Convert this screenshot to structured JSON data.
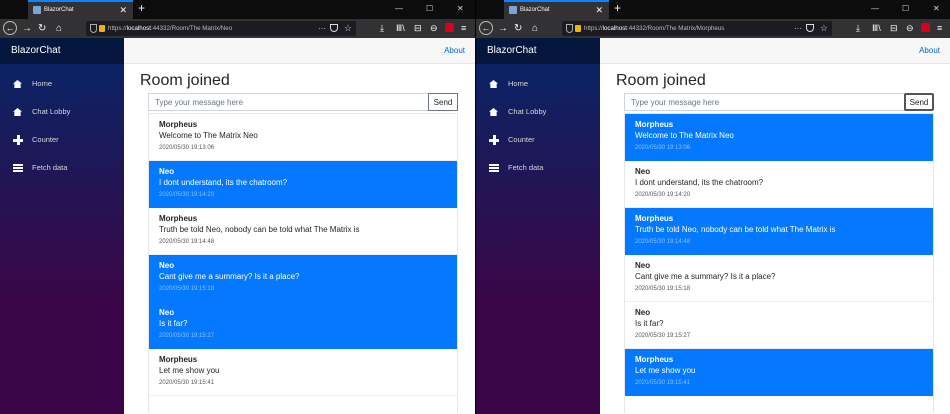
{
  "browser": {
    "tab_title": "BlazorChat",
    "tab_close": "✕",
    "new_tab": "+",
    "window_controls": [
      "—",
      "☐",
      "✕"
    ],
    "nav": {
      "back": "←",
      "forward": "→",
      "reload": "↻",
      "home": "⌂"
    },
    "menu_dots": "···",
    "toolbar": {
      "download": "⤓",
      "library": "Ⅲ\\",
      "sidebar": "⊟",
      "account": "⊖",
      "menu": "≡"
    }
  },
  "app": {
    "brand": "BlazorChat",
    "about": "About",
    "nav": [
      {
        "label": "Home",
        "icon": "home-icon"
      },
      {
        "label": "Chat Lobby",
        "icon": "home-icon"
      },
      {
        "label": "Counter",
        "icon": "plus-icon"
      },
      {
        "label": "Fetch data",
        "icon": "list-icon"
      }
    ],
    "room_title": "Room joined",
    "input_placeholder": "Type your message here",
    "send_label": "Send"
  },
  "windows": [
    {
      "url_prefix": "https://",
      "url_host": "localhost",
      "url_path": ":44332/Room/The Matrix/Neo",
      "user": "Neo",
      "messages": [
        {
          "author": "Morpheus",
          "text": "Welcome to The Matrix Neo",
          "time": "2020/05/30 19:13:06",
          "own": false
        },
        {
          "author": "Neo",
          "text": "I dont understand, its the chatroom?",
          "time": "2020/05/30 19:14:20",
          "own": true
        },
        {
          "author": "Morpheus",
          "text": "Truth be told Neo, nobody can be told what The Matrix is",
          "time": "2020/05/30 19:14:48",
          "own": false
        },
        {
          "author": "Neo",
          "text": "Cant give me a summary? Is it a place?",
          "time": "2020/05/30 19:15:18",
          "own": true
        },
        {
          "author": "Neo",
          "text": "Is it far?",
          "time": "2020/05/30 19:15:27",
          "own": true
        },
        {
          "author": "Morpheus",
          "text": "Let me show you",
          "time": "2020/05/30 19:15:41",
          "own": false
        }
      ]
    },
    {
      "url_prefix": "https://",
      "url_host": "localhost",
      "url_path": ":44332/Room/The Matrix/Morpheus",
      "user": "Morpheus",
      "messages": [
        {
          "author": "Morpheus",
          "text": "Welcome to The Matrix Neo",
          "time": "2020/05/30 19:13:06",
          "own": true
        },
        {
          "author": "Neo",
          "text": "I dont understand, its the chatroom?",
          "time": "2020/05/30 19:14:20",
          "own": false
        },
        {
          "author": "Morpheus",
          "text": "Truth be told Neo, nobody can be told what The Matrix is",
          "time": "2020/05/30 19:14:48",
          "own": true
        },
        {
          "author": "Neo",
          "text": "Cant give me a summary? Is it a place?",
          "time": "2020/05/30 19:15:18",
          "own": false
        },
        {
          "author": "Neo",
          "text": "Is it far?",
          "time": "2020/05/30 19:15:27",
          "own": false
        },
        {
          "author": "Morpheus",
          "text": "Let me show you",
          "time": "2020/05/30 19:15:41",
          "own": true
        }
      ]
    }
  ],
  "colors": {
    "own_message_bg": "#0479ff",
    "sidebar_top": "#052767",
    "sidebar_bottom": "#3a0647",
    "link": "#0366d6",
    "tab_accent": "#0a84ff"
  }
}
